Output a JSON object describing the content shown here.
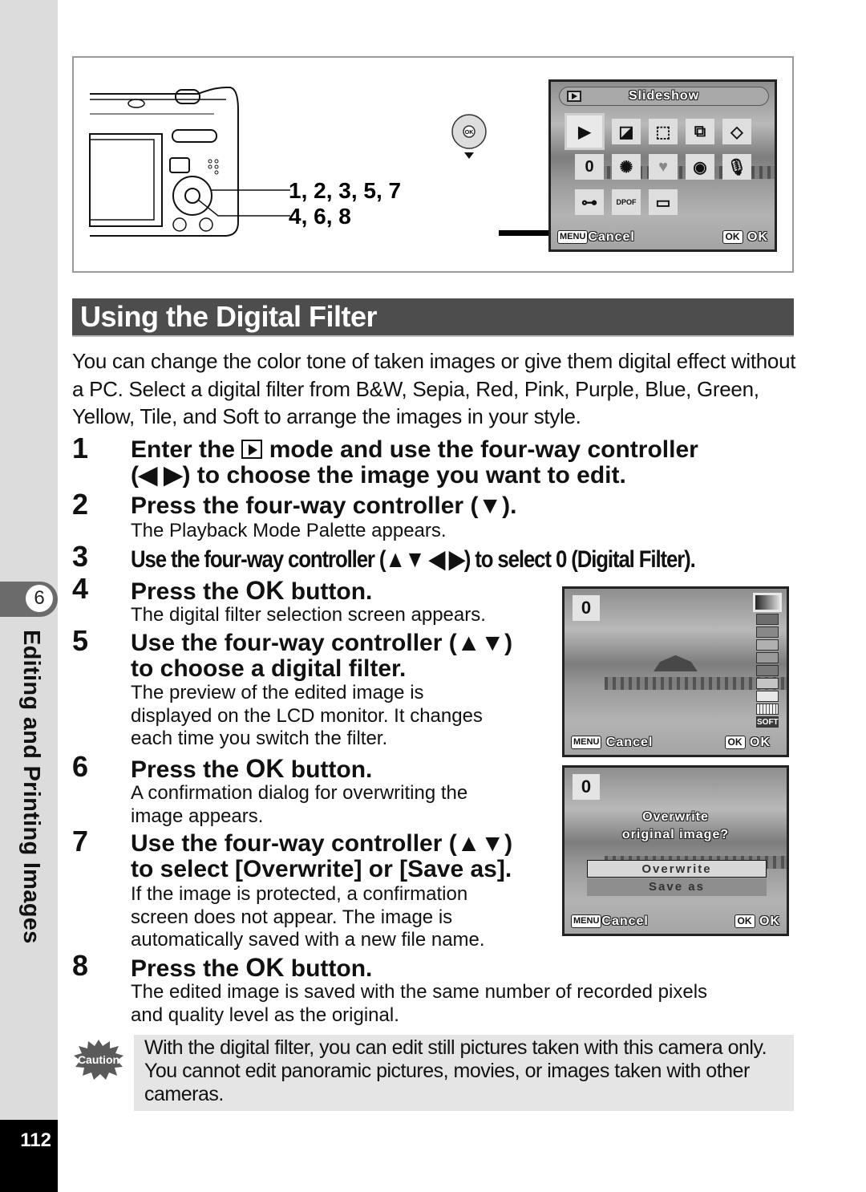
{
  "sidebar": {
    "chapter_number": "6",
    "chapter_title": "Editing and Printing Images",
    "page_number": "112"
  },
  "figure": {
    "callouts": [
      "1, 2, 3, 5, 7",
      "4, 6, 8"
    ],
    "palette_screen": {
      "title": "Slideshow",
      "icons": [
        "slideshow-icon",
        "resize-icon",
        "cropping-icon",
        "image-copy-icon",
        "rotate-icon",
        "digital-filter-icon",
        "brightness-filter-icon",
        "frame-composite-icon",
        "red-eye-icon",
        "voice-memo-icon",
        "protect-icon",
        "dpof-icon",
        "start-up-screen-icon"
      ],
      "selected_icon": "slideshow-icon",
      "footer_left_key": "MENU",
      "footer_left": "Cancel",
      "footer_right_key": "OK",
      "footer_right": "OK"
    }
  },
  "heading": "Using the Digital Filter",
  "intro": "You can change the color tone of taken images or give them digital effect without a PC. Select a digital filter from B&W, Sepia, Red, Pink, Purple, Blue, Green, Yellow, Tile, and Soft to arrange the images in your style.",
  "steps": [
    {
      "num": "1",
      "title_a": "Enter the",
      "title_b": "mode and use the four-way controller",
      "title_c": "(◀ ▶) to choose the image you want to edit."
    },
    {
      "num": "2",
      "title": "Press the four-way controller (▼).",
      "body": "The Playback Mode Palette appears."
    },
    {
      "num": "3",
      "title": "Use the four-way controller (▲▼ ◀ ▶) to select",
      "title_icon": "0",
      "title_end": "(Digital Filter)."
    },
    {
      "num": "4",
      "title_a": "Press the",
      "title_ok": "OK",
      "title_b": "button.",
      "body": "The digital filter selection screen appears."
    },
    {
      "num": "5",
      "title_1": "Use the four-way controller (▲▼)",
      "title_2": "to choose a digital filter.",
      "body": [
        "The preview of the edited image is",
        "displayed on the LCD monitor. It changes",
        "each time you switch the filter."
      ]
    },
    {
      "num": "6",
      "title_a": "Press the",
      "title_ok": "OK",
      "title_b": "button.",
      "body": [
        "A confirmation dialog for overwriting the",
        "image appears."
      ]
    },
    {
      "num": "7",
      "title_1": "Use the four-way controller (▲▼)",
      "title_2": "to select [Overwrite] or [Save as].",
      "body": [
        "If the image is protected, a confirmation",
        "screen does not appear. The image is",
        "automatically saved with a new file name."
      ]
    },
    {
      "num": "8",
      "title_a": "Press the",
      "title_ok": "OK",
      "title_b": "button.",
      "body": [
        "The edited image is saved with the same number of recorded pixels",
        "and quality level as the original."
      ]
    }
  ],
  "filter_screen": {
    "badge": "0",
    "swatches": [
      "#e0e0e0-bw-selected",
      "#6d6d6d",
      "#888888",
      "#b0b0b0",
      "#9a9a9a",
      "#7a7a7a",
      "#c4c4c4",
      "#e8e8e8",
      "tile",
      "SOFT"
    ],
    "soft_label": "SOFT",
    "footer_left_key": "MENU",
    "footer_left": "Cancel",
    "footer_right_key": "OK",
    "footer_right": "OK"
  },
  "overwrite_screen": {
    "badge": "0",
    "question_1": "Overwrite",
    "question_2": "original image?",
    "options": [
      "Overwrite",
      "Save as"
    ],
    "selected_option": "Overwrite",
    "footer_left_key": "MENU",
    "footer_left": "Cancel",
    "footer_right_key": "OK",
    "footer_right": "OK"
  },
  "caution": {
    "label": "Caution",
    "text": "With the digital filter, you can edit still pictures taken with this camera only. You cannot edit panoramic pictures, movies, or images taken with other cameras."
  }
}
